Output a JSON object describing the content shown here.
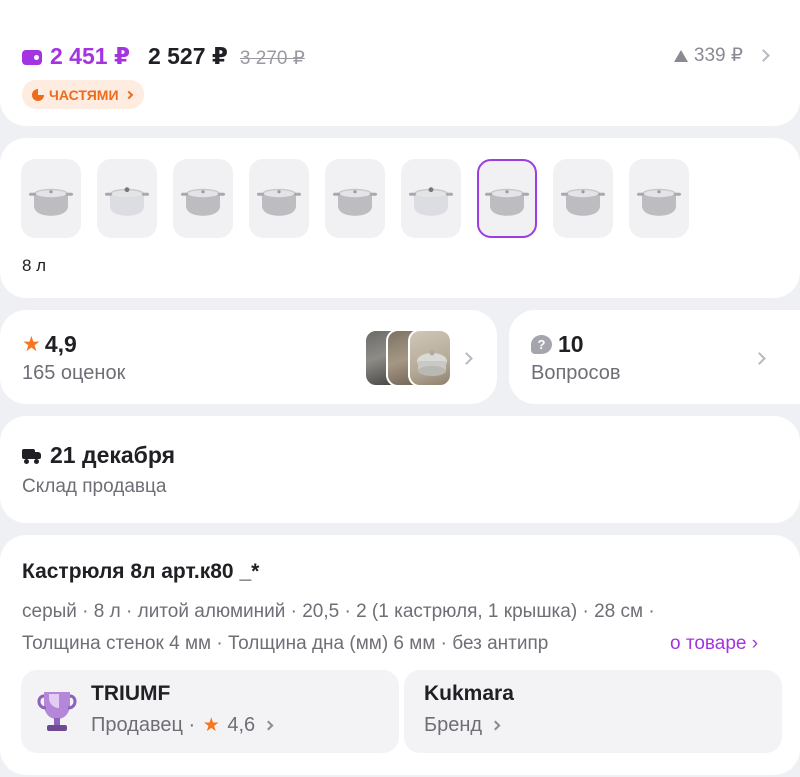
{
  "price": {
    "wallet_price": "2 451 ₽",
    "price": "2 527 ₽",
    "old_price": "3 270 ₽",
    "discount": "339 ₽",
    "installments_label": "ЧАСТЯМИ"
  },
  "variants": {
    "count": 9,
    "selected_index": 6,
    "caption": "8 л"
  },
  "rating": {
    "value": "4,9",
    "count_label": "165 оценок"
  },
  "questions": {
    "count": "10",
    "label": "Вопросов"
  },
  "delivery": {
    "date": "21 декабря",
    "source": "Склад продавца"
  },
  "product": {
    "title": "Кастрюля 8л арт.к80 _*",
    "specs_line1": "серый · 8 л · литой алюминий · 20,5 · 2 (1 кастрюля, 1 крышка) · 28 см ·",
    "specs_line2": "Толщина стенок 4 мм · Толщина дна (мм) 6 мм · без антипр",
    "more_link": "о товаре ›"
  },
  "seller": {
    "name": "TRIUMF",
    "role": "Продавец ·",
    "rating": "4,6"
  },
  "brand": {
    "name": "Kukmara",
    "role": "Бренд"
  },
  "colors": {
    "accent": "#a334e0",
    "orange": "#f06a1c",
    "star": "#f7761f"
  }
}
